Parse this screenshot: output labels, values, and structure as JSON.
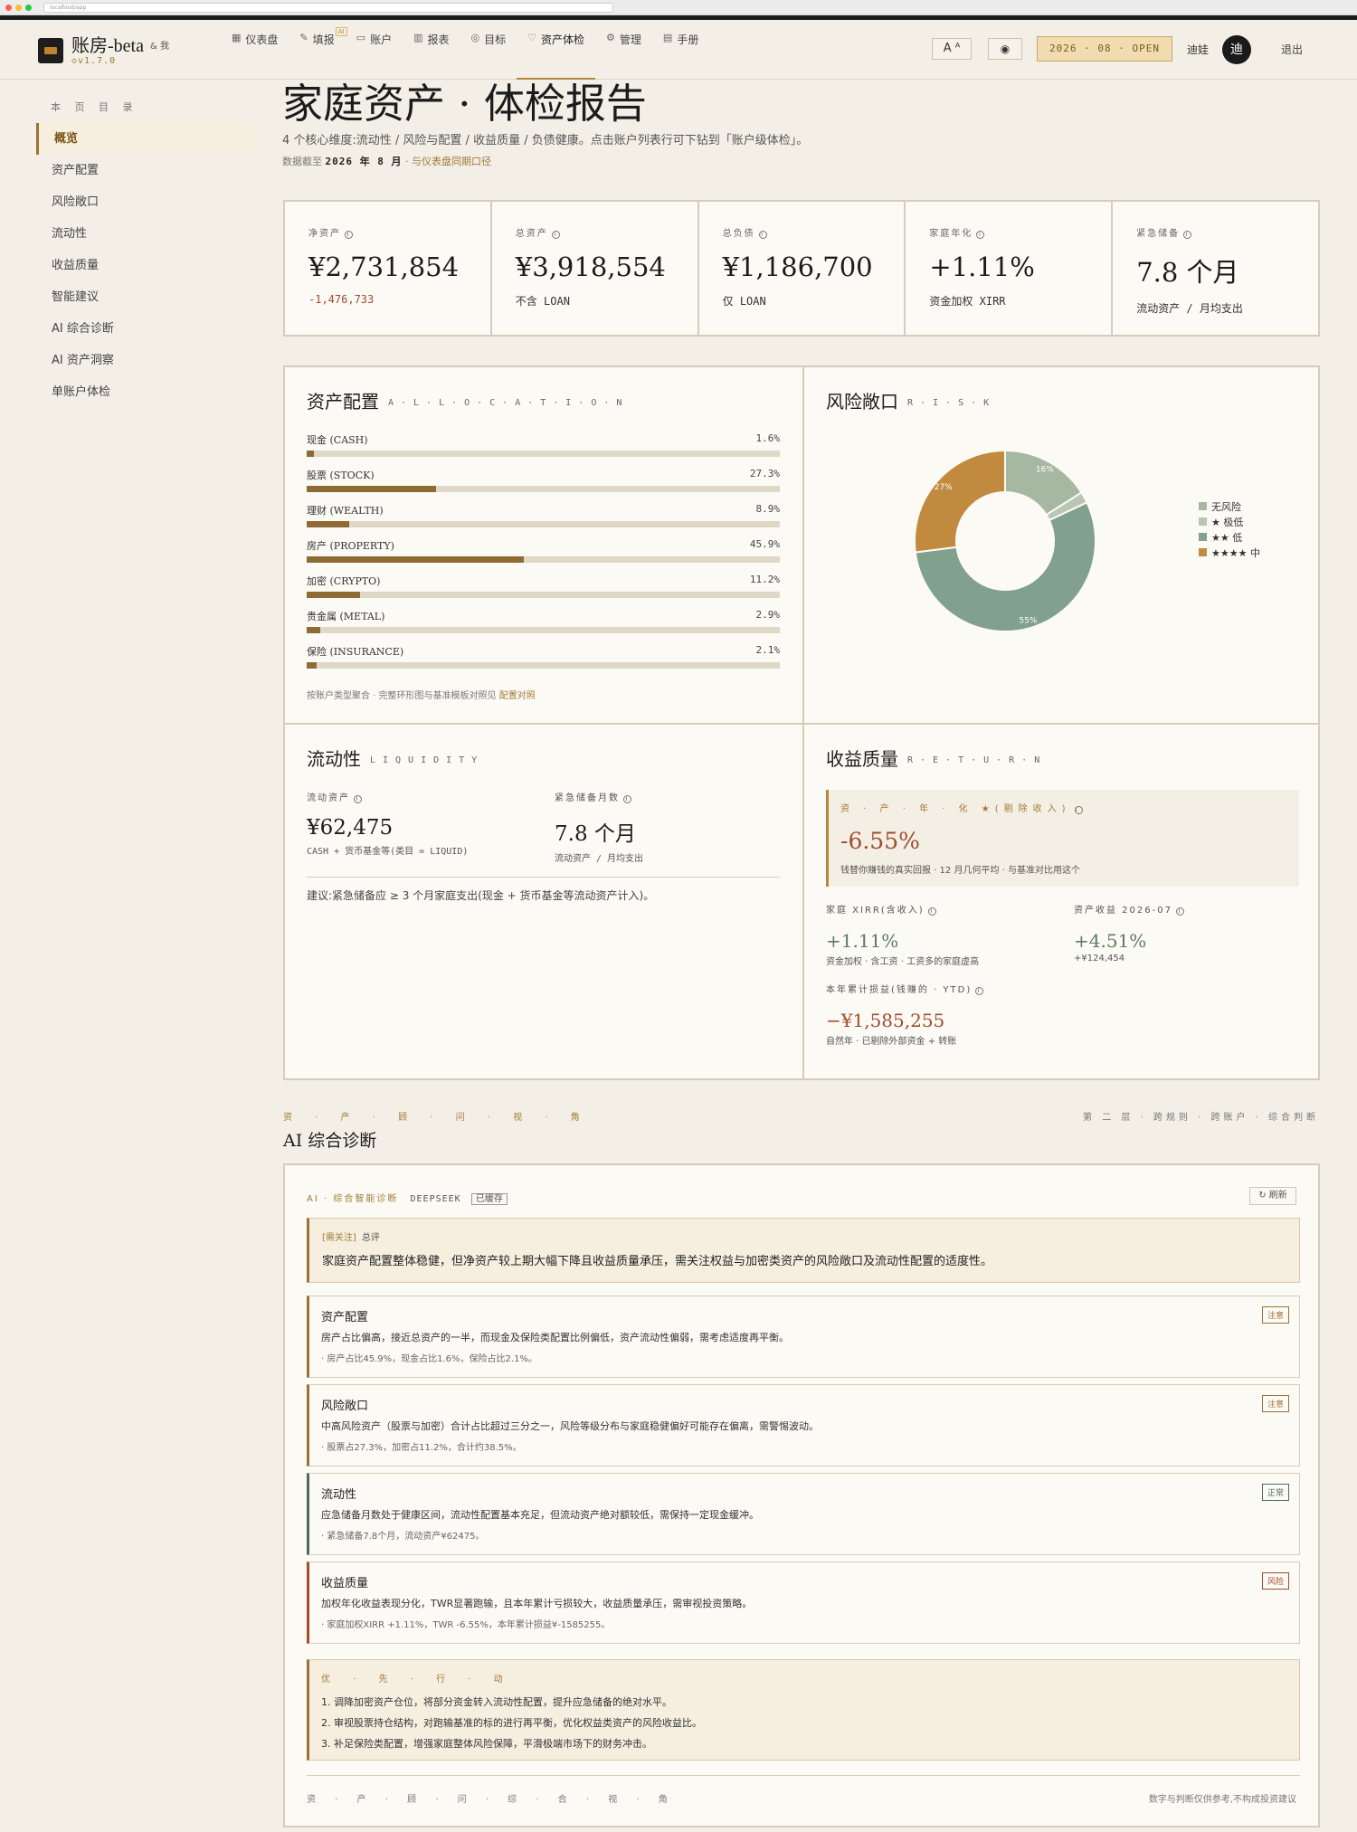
{
  "browser": {
    "url": "localhost/app"
  },
  "header": {
    "brand": "账房-beta",
    "brand_sub": "& 我",
    "version": "◇v1.7.0",
    "nav": [
      {
        "label": "仪表盘",
        "icon": "dashboard-icon"
      },
      {
        "label": "填报",
        "icon": "pen-icon",
        "badge": "AI"
      },
      {
        "label": "账户",
        "icon": "card-icon"
      },
      {
        "label": "报表",
        "icon": "bar-chart-icon"
      },
      {
        "label": "目标",
        "icon": "target-icon"
      },
      {
        "label": "资产体检",
        "icon": "heart-icon",
        "active": true
      },
      {
        "label": "管理",
        "icon": "gear-icon"
      },
      {
        "label": "手册",
        "icon": "book-icon"
      }
    ],
    "font_btn": "A ᴬ",
    "period": "2026 · 08 · OPEN",
    "user": "迪娃",
    "avatar": "迪",
    "logout": "退出"
  },
  "sidebar": {
    "title": "本 页 目 录",
    "items": [
      "概览",
      "资产配置",
      "风险敞口",
      "流动性",
      "收益质量",
      "智能建议",
      "AI 综合诊断",
      "AI 资产洞察",
      "单账户体检"
    ]
  },
  "page": {
    "title": "家庭资产 · 体检报告",
    "desc": "4 个核心维度:流动性 / 风险与配置 / 收益质量 / 负债健康。点击账户列表行可下钻到「账户级体检」。",
    "meta_prefix": "数据截至",
    "meta_date": "2026 年 8 月",
    "meta_sep": "·",
    "meta_link": "与仪表盘同期口径"
  },
  "kpis": [
    {
      "label": "净资产",
      "value": "¥2,731,854",
      "sub": "-1,476,733",
      "neg": true
    },
    {
      "label": "总资产",
      "value": "¥3,918,554",
      "sub": "不含 LOAN"
    },
    {
      "label": "总负债",
      "value": "¥1,186,700",
      "sub": "仅 LOAN"
    },
    {
      "label": "家庭年化",
      "value": "+1.11%",
      "sub": "资金加权 XIRR"
    },
    {
      "label": "紧急储备",
      "value": "7.8 个月",
      "sub": "流动资产 / 月均支出"
    }
  ],
  "allocation": {
    "title": "资产配置",
    "en": "A·L·L·O·C·A·T·I·O·N",
    "rows": [
      {
        "name": "现金 (CASH)",
        "pct_label": "1.6%",
        "pct": 1.6
      },
      {
        "name": "股票 (STOCK)",
        "pct_label": "27.3%",
        "pct": 27.3
      },
      {
        "name": "理财 (WEALTH)",
        "pct_label": "8.9%",
        "pct": 8.9
      },
      {
        "name": "房产 (PROPERTY)",
        "pct_label": "45.9%",
        "pct": 45.9
      },
      {
        "name": "加密 (CRYPTO)",
        "pct_label": "11.2%",
        "pct": 11.2
      },
      {
        "name": "贵金属 (METAL)",
        "pct_label": "2.9%",
        "pct": 2.9
      },
      {
        "name": "保险 (INSURANCE)",
        "pct_label": "2.1%",
        "pct": 2.1
      }
    ],
    "foot": "按账户类型聚合 · 完整环形图与基准模板对照见",
    "foot_link": "配置对照"
  },
  "risk": {
    "title": "风险敞口",
    "en": "R·I·S·K",
    "chart_data": {
      "type": "pie",
      "categories": [
        "无风险",
        "★ 极低",
        "★★ 低",
        "★★★★ 中"
      ],
      "values": [
        16,
        2,
        55,
        27
      ],
      "slice_labels": [
        "16%",
        "",
        "55%",
        "27%"
      ],
      "colors": [
        "#a7b8a2",
        "#b9c6b3",
        "#82a08e",
        "#c28a3e"
      ],
      "legend": "right"
    }
  },
  "liquidity": {
    "title": "流动性",
    "en": "LIQUIDITY",
    "items": [
      {
        "label": "流动资产",
        "value": "¥62,475",
        "sub": "CASH + 货币基金等(类目 = LIQUID)"
      },
      {
        "label": "紧急储备月数",
        "value": "7.8 个月",
        "sub": "流动资产 / 月均支出"
      }
    ],
    "note": "建议:紧急储备应 ≥ 3 个月家庭支出(现金 + 货币基金等流动资产计入)。"
  },
  "returns": {
    "title": "收益质量",
    "en": "R·E·T·U·R·N",
    "main_label": "资 · 产 · 年 · 化 ★(剔除收入)",
    "main_value": "-6.55%",
    "main_sub": "钱替你赚钱的真实回报 · 12 月几何平均 · 与基准对比用这个",
    "items": [
      {
        "label": "家庭 XIRR(含收入)",
        "value": "+1.11%",
        "sub": "资金加权 · 含工资 · 工资多的家庭虚高"
      },
      {
        "label": "资产收益 2026-07",
        "value": "+4.51%",
        "sub": "+¥124,454"
      },
      {
        "label": "本年累计损益(钱赚的 · YTD)",
        "value": "−¥1,585,255",
        "sub": "自然年 · 已剔除外部资金 + 转账"
      }
    ]
  },
  "ai_section": {
    "kicker": "资 · 产 · 顾 · 问 · 视 · 角",
    "right": "第 二 层 · 跨规则 · 跨账户 · 综合判断",
    "title": "AI 综合诊断",
    "head": "AI · 综合智能诊断",
    "source": "DEEPSEEK",
    "cached": "已缓存",
    "refresh": "↻ 刷新",
    "summary_tag": "[需关注]",
    "summary_tag2": "总评",
    "summary": "家庭资产配置整体稳健，但净资产较上期大幅下降且收益质量承压，需关注权益与加密类资产的风险敞口及流动性配置的适度性。",
    "cards": [
      {
        "title": "资产配置",
        "text": "房产占比偏高，接近总资产的一半，而现金及保险类配置比例偏低，资产流动性偏弱，需考虑适度再平衡。",
        "detail": "· 房产占比45.9%，现金占比1.6%，保险占比2.1%。",
        "badge": "注意",
        "color": "#9a7139"
      },
      {
        "title": "风险敞口",
        "text": "中高风险资产（股票与加密）合计占比超过三分之一，风险等级分布与家庭稳健偏好可能存在偏离，需警惕波动。",
        "detail": "· 股票占27.3%，加密占11.2%，合计约38.5%。",
        "badge": "注意",
        "color": "#9a7139"
      },
      {
        "title": "流动性",
        "text": "应急储备月数处于健康区间，流动性配置基本充足，但流动资产绝对额较低，需保持一定现金缓冲。",
        "detail": "· 紧急储备7.8个月，流动资产¥62475。",
        "badge": "正常",
        "color": "#4f6b58"
      },
      {
        "title": "收益质量",
        "text": "加权年化收益表现分化，TWR显著跑输，且本年累计亏损较大，收益质量承压，需审视投资策略。",
        "detail": "· 家庭加权XIRR +1.11%，TWR -6.55%，本年累计损益¥-1585255。",
        "badge": "风险",
        "color": "#a04c2e"
      }
    ],
    "priority_label": "优 · 先 · 行 · 动",
    "priority": [
      "1. 调降加密资产仓位，将部分资金转入流动性配置，提升应急储备的绝对水平。",
      "2. 审视股票持仓结构，对跑输基准的标的进行再平衡，优化权益类资产的风险收益比。",
      "3. 补足保险类配置，增强家庭整体风险保障，平滑极端市场下的财务冲击。"
    ],
    "foot_left": "资 · 产 · 顾 · 问 · 综 · 合 · 视 · 角",
    "foot_right": "数字与判断仅供参考,不构成投资建议"
  }
}
